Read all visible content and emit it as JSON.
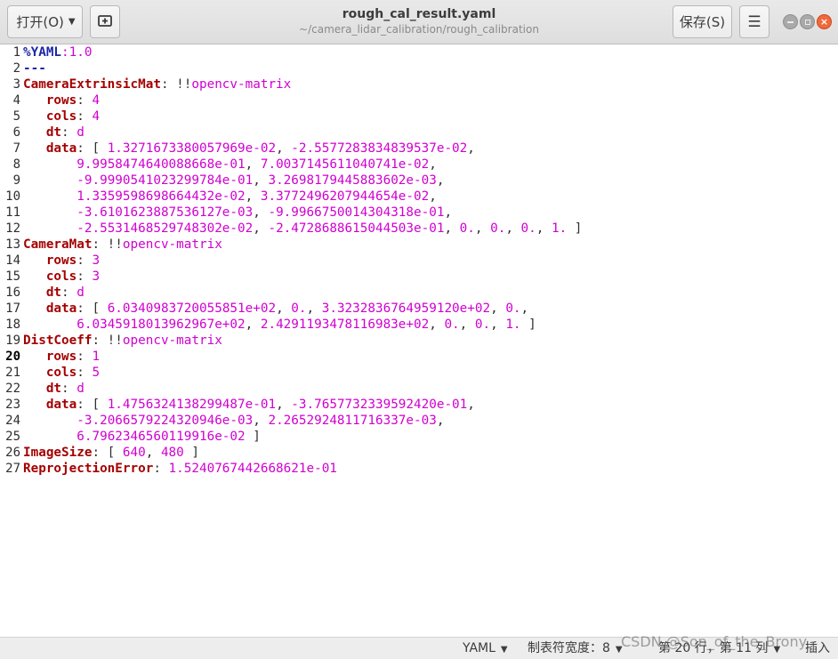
{
  "header": {
    "open_label": "打开(O)",
    "save_label": "保存(S)",
    "title": "rough_cal_result.yaml",
    "subtitle": "~/camera_lidar_calibration/rough_calibration",
    "icons": [
      "new-tab-icon",
      "hamburger-menu-icon",
      "minimize-icon",
      "maximize-icon",
      "close-icon"
    ]
  },
  "editor": {
    "current_line": 20,
    "line_numbers": [
      "1",
      "2",
      "3",
      "4",
      "5",
      "6",
      "7",
      "8",
      "9",
      "10",
      "11",
      "12",
      "13",
      "14",
      "15",
      "16",
      "17",
      "18",
      "19",
      "20",
      "21",
      "22",
      "23",
      "24",
      "25",
      "26",
      "27"
    ],
    "lines": [
      [
        {
          "t": "%YAML",
          "c": "d"
        },
        {
          "t": ":1.0",
          "c": "n"
        }
      ],
      [
        {
          "t": "---",
          "c": "d"
        }
      ],
      [
        {
          "t": "CameraExtrinsicMat",
          "c": "k"
        },
        {
          "t": ": !!",
          "c": "p"
        },
        {
          "t": "opencv-matrix",
          "c": "n"
        }
      ],
      [
        {
          "t": "   ",
          "c": "p"
        },
        {
          "t": "rows",
          "c": "k"
        },
        {
          "t": ": ",
          "c": "p"
        },
        {
          "t": "4",
          "c": "n"
        }
      ],
      [
        {
          "t": "   ",
          "c": "p"
        },
        {
          "t": "cols",
          "c": "k"
        },
        {
          "t": ": ",
          "c": "p"
        },
        {
          "t": "4",
          "c": "n"
        }
      ],
      [
        {
          "t": "   ",
          "c": "p"
        },
        {
          "t": "dt",
          "c": "k"
        },
        {
          "t": ": ",
          "c": "p"
        },
        {
          "t": "d",
          "c": "n"
        }
      ],
      [
        {
          "t": "   ",
          "c": "p"
        },
        {
          "t": "data",
          "c": "k"
        },
        {
          "t": ": [ ",
          "c": "p"
        },
        {
          "t": "1.3271673380057969e-02",
          "c": "n"
        },
        {
          "t": ", ",
          "c": "p"
        },
        {
          "t": "-2.5577283834839537e-02",
          "c": "n"
        },
        {
          "t": ",",
          "c": "p"
        }
      ],
      [
        {
          "t": "       ",
          "c": "p"
        },
        {
          "t": "9.9958474640088668e-01",
          "c": "n"
        },
        {
          "t": ", ",
          "c": "p"
        },
        {
          "t": "7.0037145611040741e-02",
          "c": "n"
        },
        {
          "t": ",",
          "c": "p"
        }
      ],
      [
        {
          "t": "       ",
          "c": "p"
        },
        {
          "t": "-9.9990541023299784e-01",
          "c": "n"
        },
        {
          "t": ", ",
          "c": "p"
        },
        {
          "t": "3.2698179445883602e-03",
          "c": "n"
        },
        {
          "t": ",",
          "c": "p"
        }
      ],
      [
        {
          "t": "       ",
          "c": "p"
        },
        {
          "t": "1.3359598698664432e-02",
          "c": "n"
        },
        {
          "t": ", ",
          "c": "p"
        },
        {
          "t": "3.3772496207944654e-02",
          "c": "n"
        },
        {
          "t": ",",
          "c": "p"
        }
      ],
      [
        {
          "t": "       ",
          "c": "p"
        },
        {
          "t": "-3.6101623887536127e-03",
          "c": "n"
        },
        {
          "t": ", ",
          "c": "p"
        },
        {
          "t": "-9.9966750014304318e-01",
          "c": "n"
        },
        {
          "t": ",",
          "c": "p"
        }
      ],
      [
        {
          "t": "       ",
          "c": "p"
        },
        {
          "t": "-2.5531468529748302e-02",
          "c": "n"
        },
        {
          "t": ", ",
          "c": "p"
        },
        {
          "t": "-2.4728688615044503e-01",
          "c": "n"
        },
        {
          "t": ", ",
          "c": "p"
        },
        {
          "t": "0.",
          "c": "n"
        },
        {
          "t": ", ",
          "c": "p"
        },
        {
          "t": "0.",
          "c": "n"
        },
        {
          "t": ", ",
          "c": "p"
        },
        {
          "t": "0.",
          "c": "n"
        },
        {
          "t": ", ",
          "c": "p"
        },
        {
          "t": "1.",
          "c": "n"
        },
        {
          "t": " ]",
          "c": "p"
        }
      ],
      [
        {
          "t": "CameraMat",
          "c": "k"
        },
        {
          "t": ": !!",
          "c": "p"
        },
        {
          "t": "opencv-matrix",
          "c": "n"
        }
      ],
      [
        {
          "t": "   ",
          "c": "p"
        },
        {
          "t": "rows",
          "c": "k"
        },
        {
          "t": ": ",
          "c": "p"
        },
        {
          "t": "3",
          "c": "n"
        }
      ],
      [
        {
          "t": "   ",
          "c": "p"
        },
        {
          "t": "cols",
          "c": "k"
        },
        {
          "t": ": ",
          "c": "p"
        },
        {
          "t": "3",
          "c": "n"
        }
      ],
      [
        {
          "t": "   ",
          "c": "p"
        },
        {
          "t": "dt",
          "c": "k"
        },
        {
          "t": ": ",
          "c": "p"
        },
        {
          "t": "d",
          "c": "n"
        }
      ],
      [
        {
          "t": "   ",
          "c": "p"
        },
        {
          "t": "data",
          "c": "k"
        },
        {
          "t": ": [ ",
          "c": "p"
        },
        {
          "t": "6.0340983720055851e+02",
          "c": "n"
        },
        {
          "t": ", ",
          "c": "p"
        },
        {
          "t": "0.",
          "c": "n"
        },
        {
          "t": ", ",
          "c": "p"
        },
        {
          "t": "3.3232836764959120e+02",
          "c": "n"
        },
        {
          "t": ", ",
          "c": "p"
        },
        {
          "t": "0.",
          "c": "n"
        },
        {
          "t": ",",
          "c": "p"
        }
      ],
      [
        {
          "t": "       ",
          "c": "p"
        },
        {
          "t": "6.0345918013962967e+02",
          "c": "n"
        },
        {
          "t": ", ",
          "c": "p"
        },
        {
          "t": "2.4291193478116983e+02",
          "c": "n"
        },
        {
          "t": ", ",
          "c": "p"
        },
        {
          "t": "0.",
          "c": "n"
        },
        {
          "t": ", ",
          "c": "p"
        },
        {
          "t": "0.",
          "c": "n"
        },
        {
          "t": ", ",
          "c": "p"
        },
        {
          "t": "1.",
          "c": "n"
        },
        {
          "t": " ]",
          "c": "p"
        }
      ],
      [
        {
          "t": "DistCoeff",
          "c": "k"
        },
        {
          "t": ": !!",
          "c": "p"
        },
        {
          "t": "opencv-matrix",
          "c": "n"
        }
      ],
      [
        {
          "t": "   ",
          "c": "p"
        },
        {
          "t": "rows",
          "c": "k"
        },
        {
          "t": ": ",
          "c": "p"
        },
        {
          "t": "1",
          "c": "n"
        }
      ],
      [
        {
          "t": "   ",
          "c": "p"
        },
        {
          "t": "cols",
          "c": "k"
        },
        {
          "t": ": ",
          "c": "p"
        },
        {
          "t": "5",
          "c": "n"
        }
      ],
      [
        {
          "t": "   ",
          "c": "p"
        },
        {
          "t": "dt",
          "c": "k"
        },
        {
          "t": ": ",
          "c": "p"
        },
        {
          "t": "d",
          "c": "n"
        }
      ],
      [
        {
          "t": "   ",
          "c": "p"
        },
        {
          "t": "data",
          "c": "k"
        },
        {
          "t": ": [ ",
          "c": "p"
        },
        {
          "t": "1.4756324138299487e-01",
          "c": "n"
        },
        {
          "t": ", ",
          "c": "p"
        },
        {
          "t": "-3.7657732339592420e-01",
          "c": "n"
        },
        {
          "t": ",",
          "c": "p"
        }
      ],
      [
        {
          "t": "       ",
          "c": "p"
        },
        {
          "t": "-3.2066579224320946e-03",
          "c": "n"
        },
        {
          "t": ", ",
          "c": "p"
        },
        {
          "t": "2.2652924811716337e-03",
          "c": "n"
        },
        {
          "t": ",",
          "c": "p"
        }
      ],
      [
        {
          "t": "       ",
          "c": "p"
        },
        {
          "t": "6.7962346560119916e-02",
          "c": "n"
        },
        {
          "t": " ]",
          "c": "p"
        }
      ],
      [
        {
          "t": "ImageSize",
          "c": "k"
        },
        {
          "t": ": [ ",
          "c": "p"
        },
        {
          "t": "640",
          "c": "n"
        },
        {
          "t": ", ",
          "c": "p"
        },
        {
          "t": "480",
          "c": "n"
        },
        {
          "t": " ]",
          "c": "p"
        }
      ],
      [
        {
          "t": "ReprojectionError",
          "c": "k"
        },
        {
          "t": ": ",
          "c": "p"
        },
        {
          "t": "1.5240767442668621e-01",
          "c": "n"
        }
      ]
    ]
  },
  "statusbar": {
    "language": "YAML",
    "tab_width": "制表符宽度：8",
    "position": "第 20 行，第 11 列",
    "insert_mode": "插入"
  },
  "watermark": "CSDN @Son_of_the_Brony",
  "colors": {
    "key": "#a40000",
    "directive": "#1d28a8",
    "value": "#d000d0",
    "close_button": "#f0693a"
  }
}
